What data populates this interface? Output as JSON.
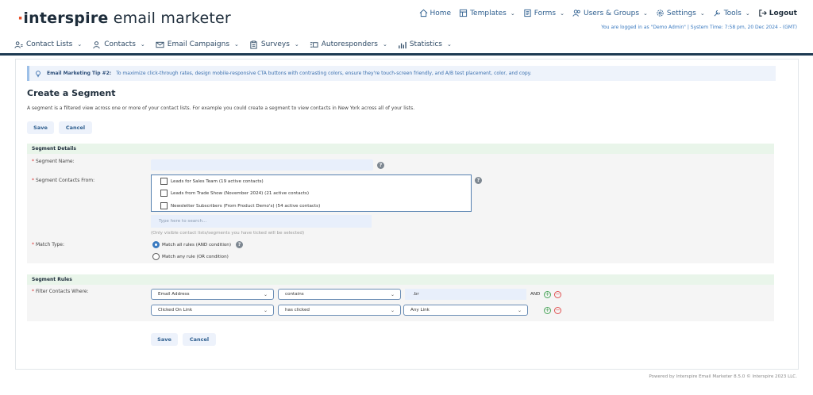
{
  "header": {
    "logo_main": "interspire",
    "logo_sub": " email marketer",
    "nav": {
      "home": "Home",
      "templates": "Templates",
      "forms": "Forms",
      "users_groups": "Users & Groups",
      "settings": "Settings",
      "tools": "Tools",
      "logout": "Logout"
    },
    "login_info": "You are logged in as \"Demo Admin\" | System Time: 7:58 pm, 20 Dec 2024 - (GMT)"
  },
  "main_nav": {
    "contact_lists": "Contact Lists",
    "contacts": "Contacts",
    "email_campaigns": "Email Campaigns",
    "surveys": "Surveys",
    "autoresponders": "Autoresponders",
    "statistics": "Statistics"
  },
  "tip": {
    "label": "Email Marketing Tip #2:",
    "text": "To maximize click-through rates, design mobile-responsive CTA buttons with contrasting colors, ensure they're touch-screen friendly, and A/B test placement, color, and copy."
  },
  "page": {
    "title": "Create a Segment",
    "description": "A segment is a filtered view across one or more of your contact lists. For example you could create a segment to view contacts in New York across all of your lists.",
    "save_label": "Save",
    "cancel_label": "Cancel"
  },
  "details": {
    "heading": "Segment Details",
    "name_label": "Segment Name:",
    "name_value": "",
    "contacts_from_label": "Segment Contacts From:",
    "lists": [
      {
        "label": "Leads for Sales Team (19 active contacts)",
        "checked": false
      },
      {
        "label": "Leads from Trade Show (November 2024) (21 active contacts)",
        "checked": false
      },
      {
        "label": "Newsletter Subscribers (From Product Demo's) (54 active contacts)",
        "checked": false
      }
    ],
    "search_placeholder": "Type here to search...",
    "search_hint": "(Only visible contact lists/segments you have ticked will be selected)",
    "match_type_label": "Match Type:",
    "match_all": "Match all rules (AND condition)",
    "match_any": "Match any rule (OR condition)",
    "match_selected": "all"
  },
  "rules": {
    "heading": "Segment Rules",
    "filter_label": "Filter Contacts Where:",
    "rows": [
      {
        "field": "Email Address",
        "operator": "contains",
        "value": ".br",
        "connector": "AND"
      },
      {
        "field": "Clicked On Link",
        "operator": "has clicked",
        "value": "Any Link",
        "connector": ""
      }
    ]
  },
  "bottom_buttons": {
    "save_label": "Save",
    "cancel_label": "Cancel"
  },
  "footer": {
    "text": "Powered by Interspire Email Marketer 8.5.0 © Interspire 2023 LLC."
  },
  "colors": {
    "brand_dark": "#1e2d3b",
    "brand_accent": "#e8512a",
    "link_blue": "#2f5f8f",
    "section_green": "#e9f5ea"
  }
}
